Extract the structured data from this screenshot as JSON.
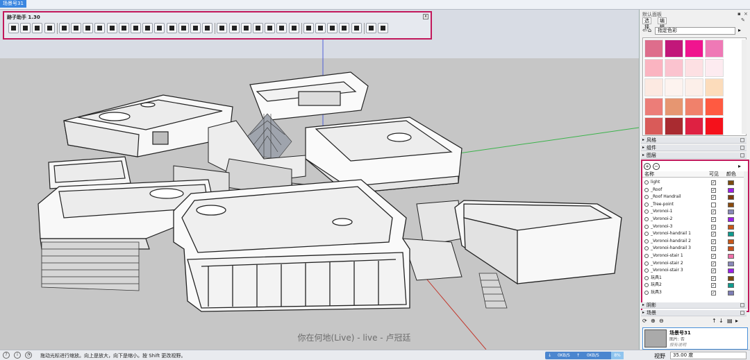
{
  "window": {
    "scene_tab": "场景号31"
  },
  "toolbar": {
    "title": "跡子助手 1.30",
    "close_label": "x",
    "tool_groups": [
      [
        "wall-tool-icon",
        "column-tool-icon",
        "stair-tool-icon",
        "bar-chart-tool-icon"
      ],
      [
        "array-tool-icon",
        "road-tool-icon",
        "curve-tool-icon",
        "path-tool-icon",
        "arch-tool-icon",
        "spiral-tool-icon",
        "bend-tool-icon",
        "slab-tool-icon",
        "line-tool-icon",
        "contour-tool-icon",
        "split-tool-icon",
        "box-tool-icon",
        "fold-tool-icon"
      ],
      [
        "bridge-tool-icon",
        "chain-tool-icon",
        "wave-tool-icon",
        "snail-tool-icon",
        "flag-tool-icon",
        "fence-tool-icon",
        "railing-tool-icon"
      ],
      [
        "mirror-tool-icon",
        "grid-tool-icon",
        "panel-tool-icon",
        "tree-tool-icon",
        "brush-tool-icon"
      ],
      [
        "settings-tool-icon",
        "help-tool-icon"
      ]
    ]
  },
  "viewport": {
    "caption": "你在何地(Live) - live - 卢冠廷"
  },
  "status_bar": {
    "help_text": "拖动光标进行缩放。向上是放大，向下是缩小。按 Shift 更改视野。",
    "upload": "0KB/S",
    "download": "0KB/S",
    "percent": "8%",
    "zoom_label": "视野",
    "zoom_value": "35.00 度"
  },
  "tray": {
    "title": "默认面板",
    "tabs": [
      "选择",
      "编辑"
    ],
    "material_select": "指定色彩",
    "swatch_colors": [
      "#de6d8c",
      "#c2177a",
      "#f0148f",
      "#ef79b6",
      "#fbb4c1",
      "#fbc3cf",
      "#fde0e3",
      "#fdebf0",
      "#fce9e1",
      "#fdf3ef",
      "#fcefe9",
      "#fcdcbb",
      "#ec7d78",
      "#e69671",
      "#f0816b",
      "#ff5a41",
      "#d95b59",
      "#a92b30",
      "#de2142",
      "#f5111b"
    ],
    "panels_top": [
      "风格",
      "组件",
      "图层"
    ],
    "layers": {
      "header_name": "名称",
      "header_visible": "可见",
      "header_color": "颜色",
      "rows": [
        {
          "name": "light",
          "visible": "✓",
          "color": "#7a4a0c"
        },
        {
          "name": "_Roof",
          "visible": "✓",
          "color": "#9b1fe8"
        },
        {
          "name": "_Roof Handrail",
          "visible": "✓",
          "color": "#7f3c0e"
        },
        {
          "name": "_Tree-point",
          "visible": "",
          "color": "#8a4a0d"
        },
        {
          "name": "_Voronoi-1",
          "visible": "✓",
          "color": "#8888b8"
        },
        {
          "name": "_Voronoi-2",
          "visible": "✓",
          "color": "#9b1fe8"
        },
        {
          "name": "_Voronoi-3",
          "visible": "✓",
          "color": "#c75618"
        },
        {
          "name": "_Voronoi-handrail 1",
          "visible": "✓",
          "color": "#0e9b8e"
        },
        {
          "name": "_Voronoi-handrail 2",
          "visible": "✓",
          "color": "#c75618"
        },
        {
          "name": "_Voronoi-handrail 3",
          "visible": "✓",
          "color": "#c7501a"
        },
        {
          "name": "_Voronoi-stair 1",
          "visible": "✓",
          "color": "#ef6fa8"
        },
        {
          "name": "_Voronoi-stair 2",
          "visible": "✓",
          "color": "#8888b8"
        },
        {
          "name": "_Voronoi-stair 3",
          "visible": "✓",
          "color": "#9b1fe8"
        },
        {
          "name": "玩具1",
          "visible": "✓",
          "color": "#7a4a0c"
        },
        {
          "name": "玩具2",
          "visible": "✓",
          "color": "#0e9b8e"
        },
        {
          "name": "玩具3",
          "visible": "✓",
          "color": "#7d7db5"
        }
      ]
    },
    "panels_bottom": [
      "阴影",
      "场景"
    ],
    "scene": {
      "name": "场景号31",
      "sub1": "图片: 否",
      "sub2": "授有说明"
    }
  },
  "colors": {
    "accent_frame": "#c2185b",
    "selection_blue": "#3b86e0"
  }
}
